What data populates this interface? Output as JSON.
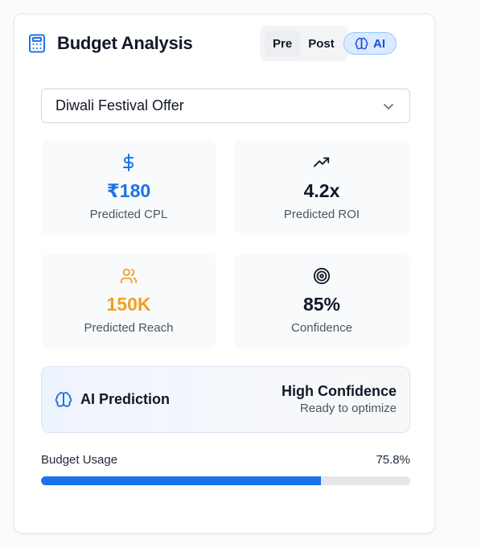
{
  "header": {
    "title": "Budget Analysis",
    "title_icon": "calculator-icon",
    "toggle": [
      "Pre",
      "Post"
    ],
    "toggle_active": "Pre",
    "ai_label": "AI",
    "ai_icon": "brain-icon"
  },
  "campaign_select": {
    "value": "Diwali Festival Offer",
    "icon": "chevron-down-icon"
  },
  "stats": [
    {
      "icon": "dollar-icon",
      "value": "₹180",
      "label": "Predicted CPL",
      "color": "#1a73e8"
    },
    {
      "icon": "trending-up-icon",
      "value": "4.2x",
      "label": "Predicted ROI",
      "color": "#111827"
    },
    {
      "icon": "users-icon",
      "value": "150K",
      "label": "Predicted Reach",
      "color": "#f0a020"
    },
    {
      "icon": "target-icon",
      "value": "85%",
      "label": "Confidence",
      "color": "#111827"
    }
  ],
  "prediction": {
    "icon": "brain-icon",
    "label": "AI Prediction",
    "confidence": "High Confidence",
    "status": "Ready to optimize"
  },
  "budget_usage": {
    "label": "Budget Usage",
    "value_text": "75.8%",
    "fraction": 0.758
  },
  "colors": {
    "accent": "#1a73e8",
    "orange": "#f0a020"
  }
}
